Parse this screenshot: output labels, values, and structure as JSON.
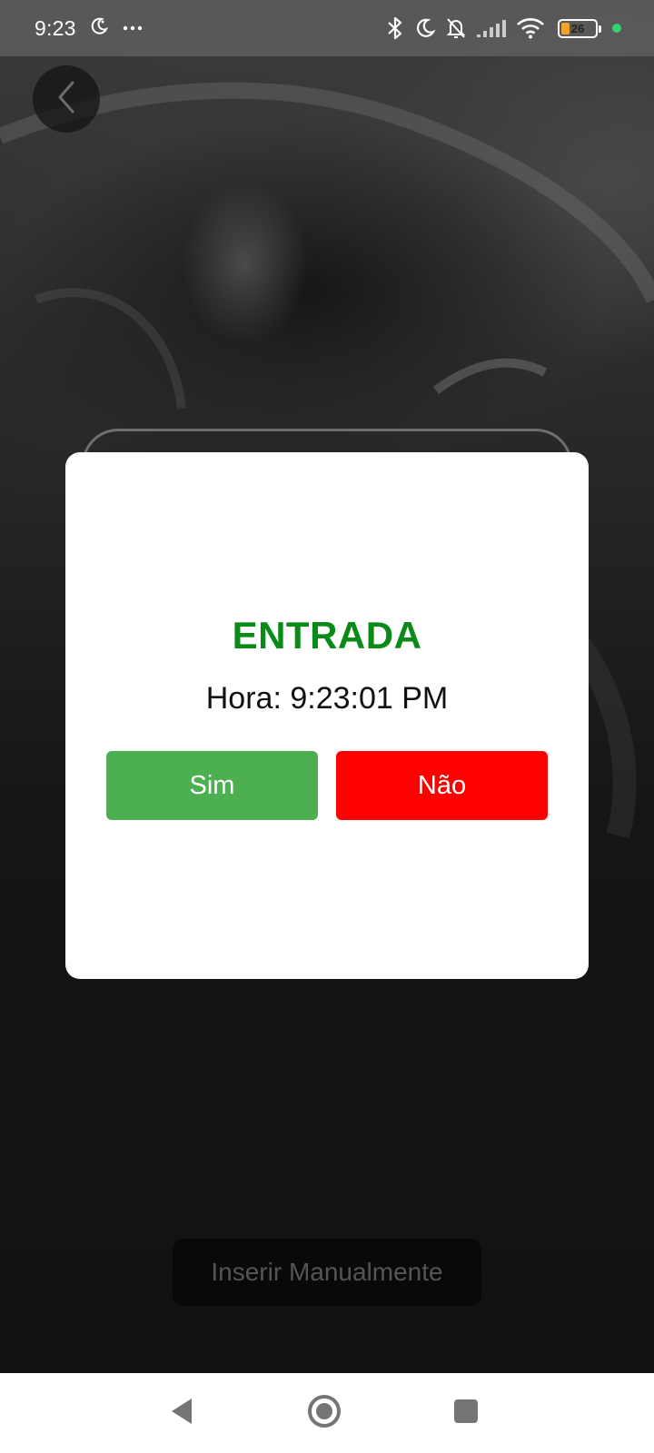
{
  "status_bar": {
    "time": "9:23",
    "battery_level": "26",
    "battery_fraction": 0.26,
    "icons": [
      "moon-cloud-icon",
      "more-dots-icon",
      "bluetooth-icon",
      "do-not-disturb-moon-icon",
      "bell-off-icon",
      "signal-icon",
      "wifi-icon",
      "battery-icon",
      "camera-in-use-dot"
    ]
  },
  "dialog": {
    "title": "ENTRADA",
    "time_text": "Hora: 9:23:01 PM",
    "yes_label": "Sim",
    "no_label": "Não",
    "title_color": "#0a8a17",
    "yes_color": "#4caf50",
    "no_color": "#ff0000"
  },
  "manual": {
    "label": "Inserir Manualmente"
  },
  "nav": {
    "icons": [
      "back-triangle-icon",
      "home-circle-icon",
      "recents-square-icon"
    ]
  }
}
